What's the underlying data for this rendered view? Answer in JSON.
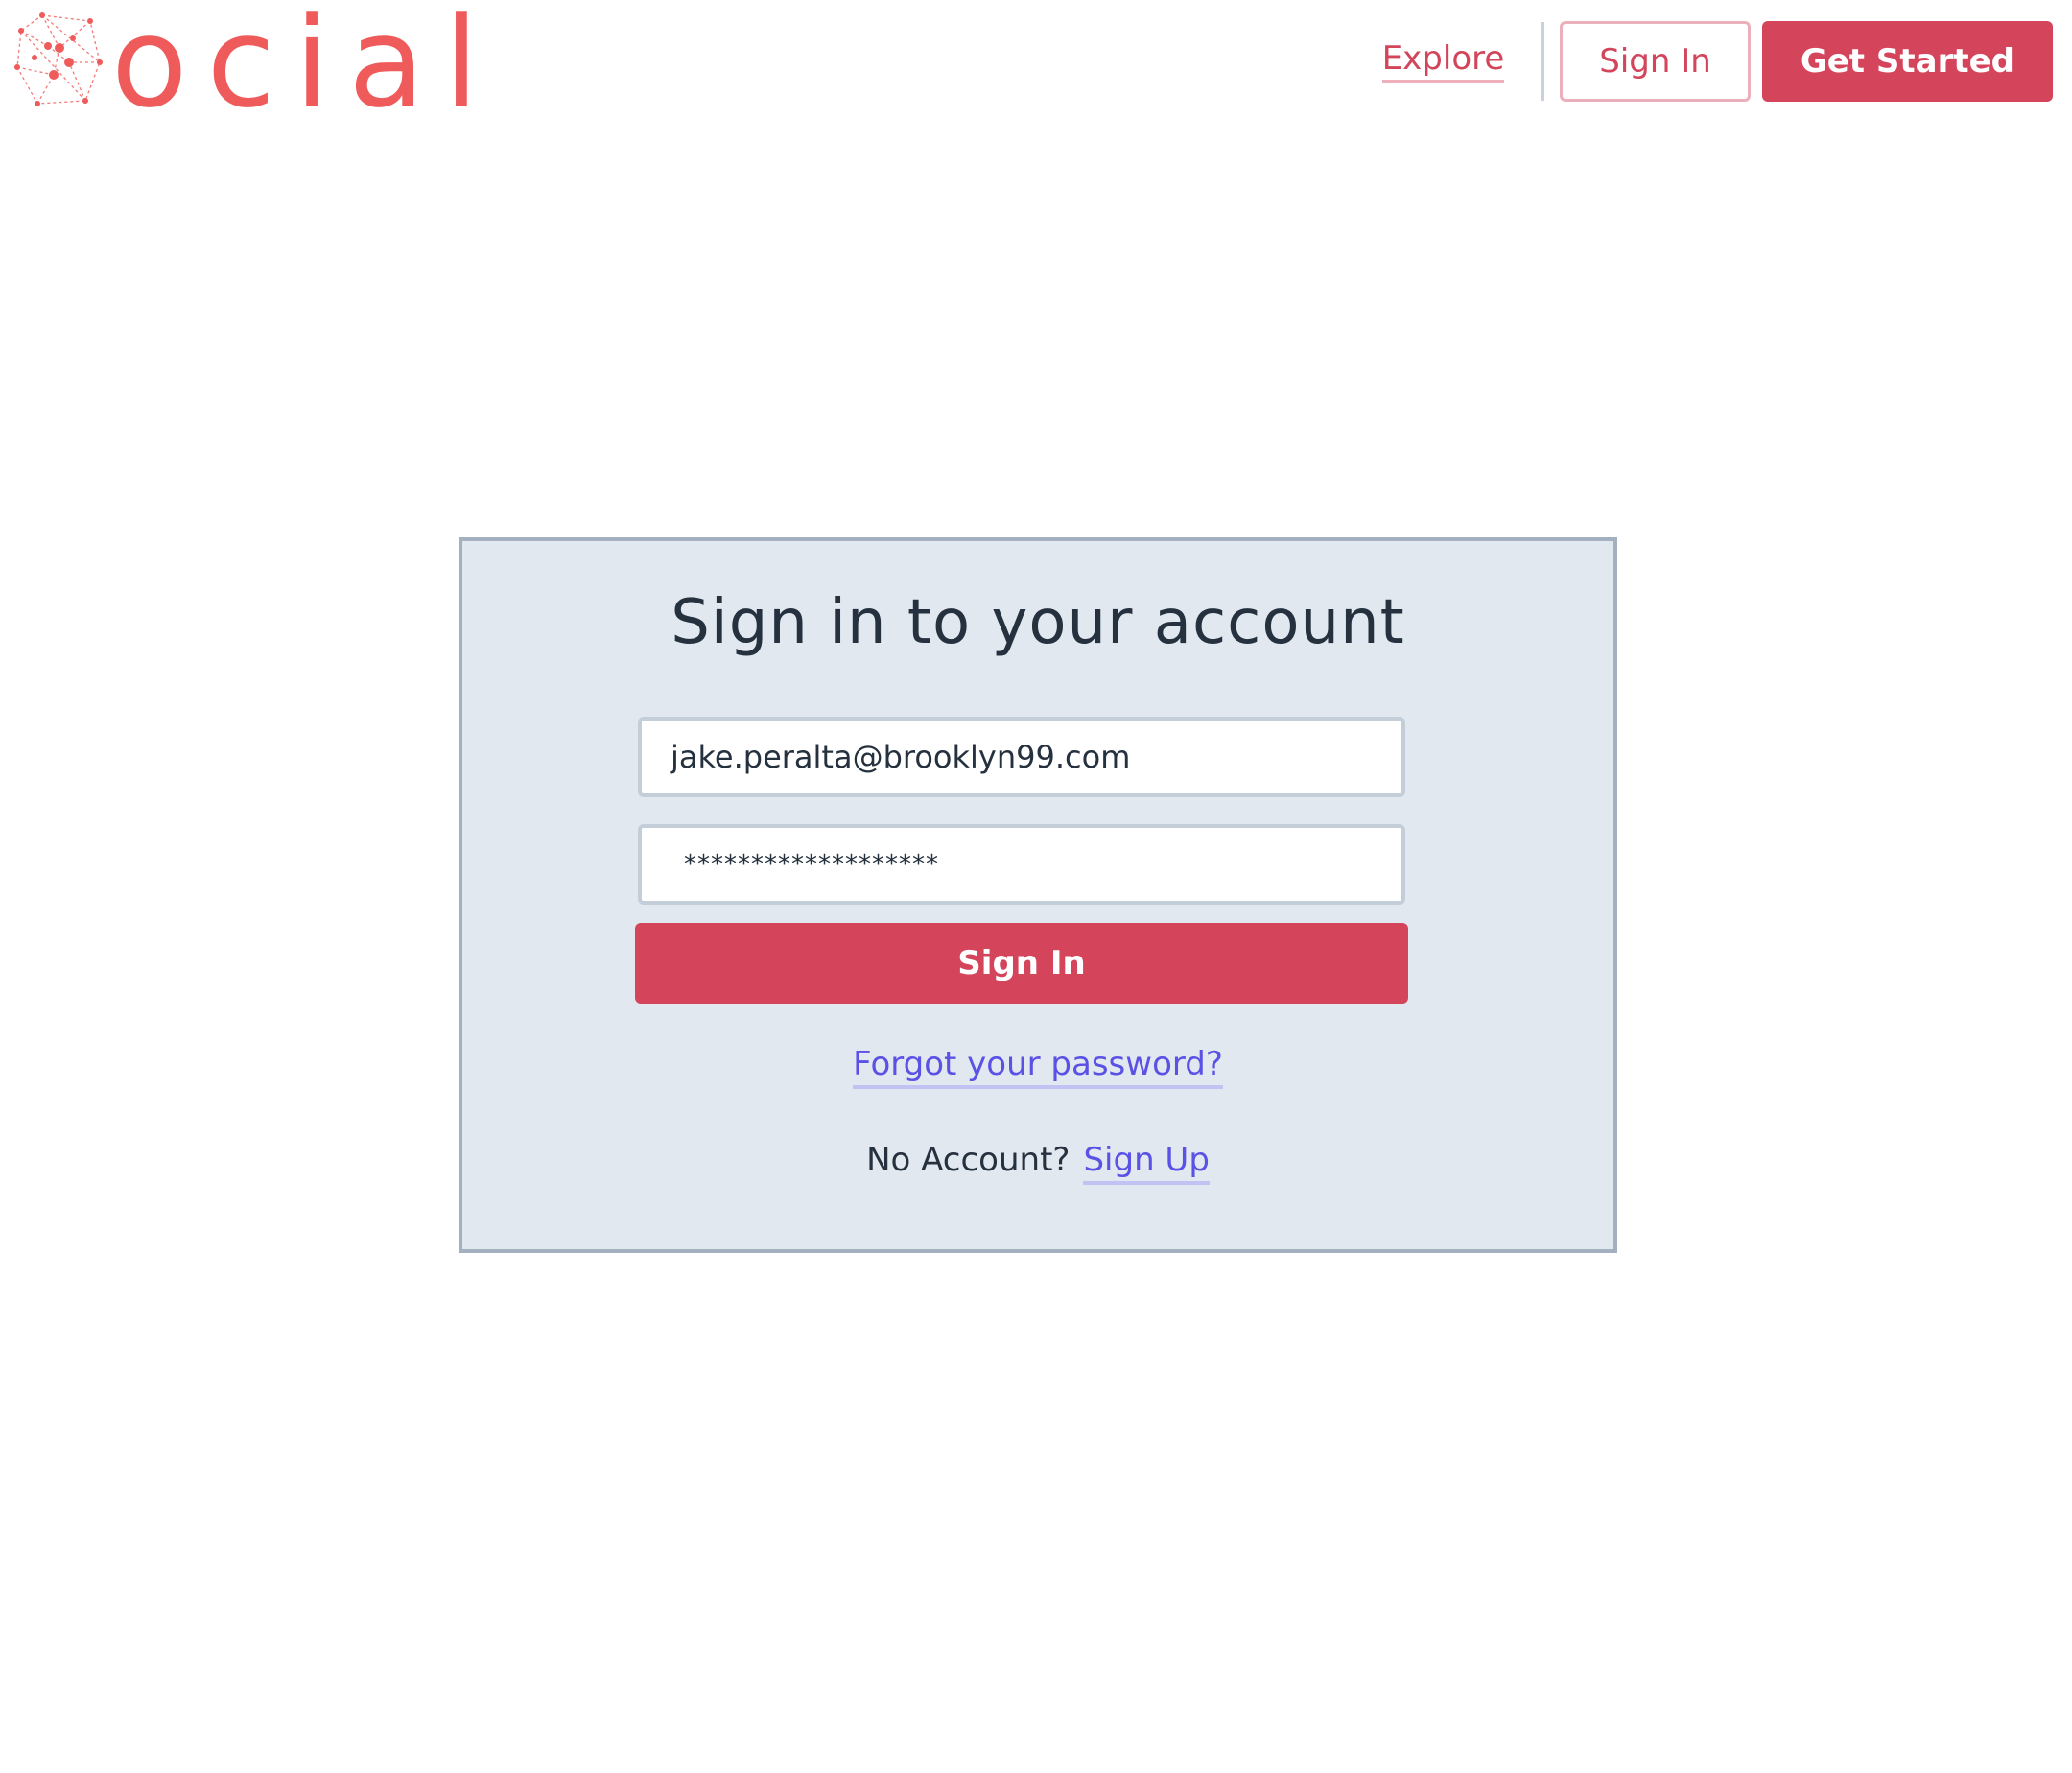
{
  "brand": {
    "logo_text": "ocial",
    "color": "#ef5b5b"
  },
  "nav": {
    "explore_label": "Explore",
    "signin_label": "Sign In",
    "get_started_label": "Get Started"
  },
  "signin_card": {
    "title": "Sign in to your account",
    "email_value": "jake.peralta@brooklyn99.com",
    "password_value": "*******************",
    "submit_label": "Sign In",
    "forgot_label": "Forgot your password?",
    "no_account_label": "No Account?",
    "signup_label": "Sign Up"
  },
  "colors": {
    "accent": "#d4445a",
    "link": "#5a51e5",
    "card_bg": "#e2e8ef",
    "card_border": "#a2b0bf"
  }
}
